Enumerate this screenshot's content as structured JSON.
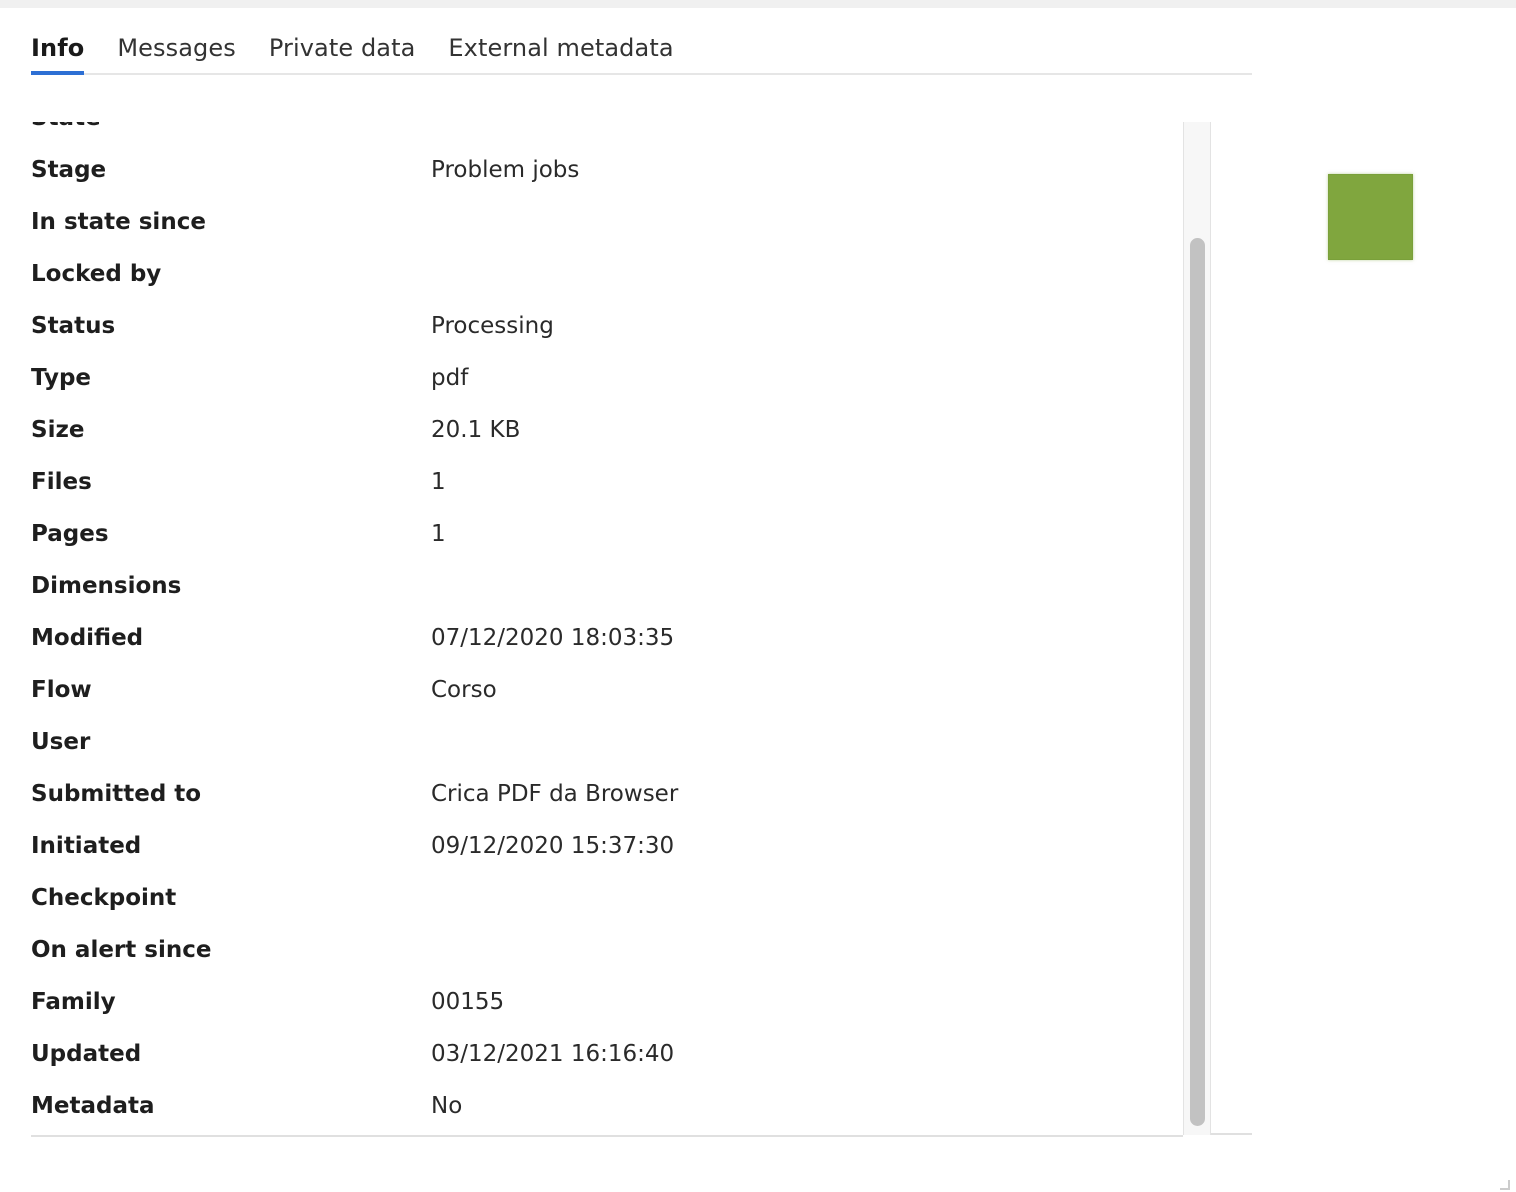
{
  "tabs": [
    {
      "label": "Info"
    },
    {
      "label": "Messages"
    },
    {
      "label": "Private data"
    },
    {
      "label": "External metadata"
    }
  ],
  "active_tab": "Info",
  "fields": [
    {
      "label": "State",
      "value": ""
    },
    {
      "label": "Stage",
      "value": "Problem jobs"
    },
    {
      "label": "In state since",
      "value": ""
    },
    {
      "label": "Locked by",
      "value": ""
    },
    {
      "label": "Status",
      "value": "Processing"
    },
    {
      "label": "Type",
      "value": "pdf"
    },
    {
      "label": "Size",
      "value": "20.1 KB"
    },
    {
      "label": "Files",
      "value": "1"
    },
    {
      "label": "Pages",
      "value": "1"
    },
    {
      "label": "Dimensions",
      "value": ""
    },
    {
      "label": "Modified",
      "value": "07/12/2020 18:03:35"
    },
    {
      "label": "Flow",
      "value": "Corso"
    },
    {
      "label": "User",
      "value": ""
    },
    {
      "label": "Submitted to",
      "value": "Crica PDF da Browser"
    },
    {
      "label": "Initiated",
      "value": "09/12/2020 15:37:30"
    },
    {
      "label": "Checkpoint",
      "value": ""
    },
    {
      "label": "On alert since",
      "value": ""
    },
    {
      "label": "Family",
      "value": "00155"
    },
    {
      "label": "Updated",
      "value": "03/12/2021 16:16:40"
    },
    {
      "label": "Metadata",
      "value": "No"
    }
  ],
  "preview": {
    "color": "#80a63e"
  },
  "colors": {
    "accent": "#2d6fd4"
  }
}
